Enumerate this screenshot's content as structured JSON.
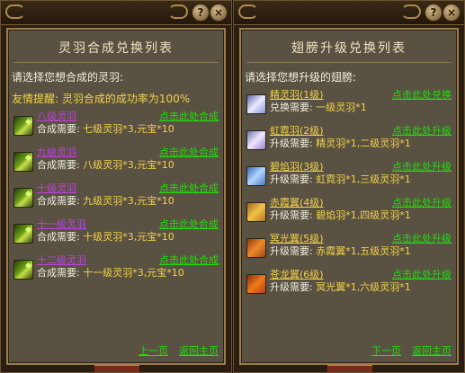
{
  "left": {
    "title": "灵羽合成兑换列表",
    "prompt": "请选择您想合成的灵羽:",
    "tip": "友情提醒: 灵羽合成的成功率为100%",
    "items": [
      {
        "name": "八级灵羽",
        "req_label": "合成需要:",
        "req_value": "七级灵羽*3,元宝*10",
        "action": "点击此处合成"
      },
      {
        "name": "九级灵羽",
        "req_label": "合成需要:",
        "req_value": "八级灵羽*3,元宝*10",
        "action": "点击此处合成"
      },
      {
        "name": "十级灵羽",
        "req_label": "合成需要:",
        "req_value": "九级灵羽*3,元宝*10",
        "action": "点击此处合成"
      },
      {
        "name": "十一级灵羽",
        "req_label": "合成需要:",
        "req_value": "十级灵羽*3,元宝*10",
        "action": "点击此处合成"
      },
      {
        "name": "十二级灵羽",
        "req_label": "合成需要:",
        "req_value": "十一级灵羽*3,元宝*10",
        "action": "点击此处合成"
      }
    ],
    "nav_prev": "上一页",
    "nav_home": "返回主页"
  },
  "right": {
    "title": "翅膀升级兑换列表",
    "prompt": "请选择您想升级的翅膀:",
    "items": [
      {
        "name": "精灵羽(1级)",
        "req_label": "兑换需要:",
        "req_value": "一级灵羽*1",
        "action": "点击此处兑换"
      },
      {
        "name": "虹霓羽(2级)",
        "req_label": "升级需要:",
        "req_value": "精灵羽*1,二级灵羽*1",
        "action": "点击此处升级"
      },
      {
        "name": "碧焰羽(3级)",
        "req_label": "升级需要:",
        "req_value": "虹霓羽*1,三级灵羽*1",
        "action": "点击此处升级"
      },
      {
        "name": "赤霞翼(4级)",
        "req_label": "升级需要:",
        "req_value": "碧焰羽*1,四级灵羽*1",
        "action": "点击此处升级"
      },
      {
        "name": "冥光翼(5级)",
        "req_label": "升级需要:",
        "req_value": "赤霞翼*1,五级灵羽*1",
        "action": "点击此处升级"
      },
      {
        "name": "苍龙翼(6级)",
        "req_label": "升级需要:",
        "req_value": "冥光翼*1,六级灵羽*1",
        "action": "点击此处升级"
      }
    ],
    "nav_next": "下一页",
    "nav_home": "返回主页"
  },
  "controls": {
    "help": "?",
    "close": "×"
  },
  "icons": {
    "left_item": "green-feather-icon",
    "right_items": [
      "white-wing-icon",
      "lavender-wing-icon",
      "blue-wing-icon",
      "gold-wing-icon",
      "orange-wing-icon",
      "red-wing-icon"
    ]
  },
  "colors": {
    "link": "#1ee00a",
    "item_name_left": "#c040e0",
    "item_name_right": "#f4d24a",
    "value": "#f4d24a",
    "panel_bg": "#595141"
  }
}
